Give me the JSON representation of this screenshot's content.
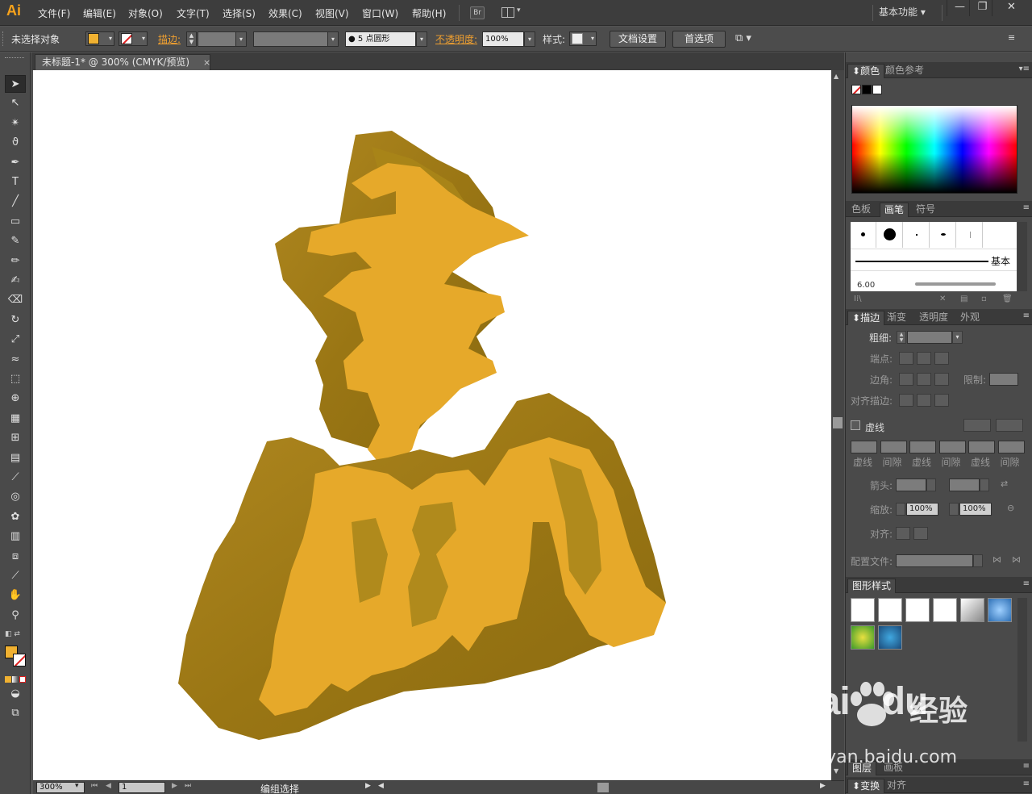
{
  "app": {
    "logo": "Ai"
  },
  "menu": [
    "文件(F)",
    "编辑(E)",
    "对象(O)",
    "文字(T)",
    "选择(S)",
    "效果(C)",
    "视图(V)",
    "窗口(W)",
    "帮助(H)"
  ],
  "bridge_button": "Br",
  "arrange_button": "▾",
  "workspace": "基本功能 ▾",
  "window_buttons": {
    "minimize": "—",
    "restore": "❐",
    "close": "✕"
  },
  "control_bar": {
    "selection_label": "未选择对象",
    "fill_color": "#f0b131",
    "stroke_label": "描边:",
    "brush_label": "●  5  点圆形",
    "opacity_label": "不透明度:",
    "opacity_value": "100%",
    "style_label": "样式:",
    "doc_setup_button": "文档设置",
    "prefs_button": "首选项"
  },
  "document_tab": {
    "title": "未标题-1* @ 300% (CMYK/预览)",
    "close": "×"
  },
  "tools": [
    {
      "name": "selection-tool",
      "glyph": "➤"
    },
    {
      "name": "direct-selection-tool",
      "glyph": "↖"
    },
    {
      "name": "magic-wand-tool",
      "glyph": "✴"
    },
    {
      "name": "lasso-tool",
      "glyph": "ϑ"
    },
    {
      "name": "pen-tool",
      "glyph": "✒"
    },
    {
      "name": "type-tool",
      "glyph": "T"
    },
    {
      "name": "line-tool",
      "glyph": "╱"
    },
    {
      "name": "rectangle-tool",
      "glyph": "▭"
    },
    {
      "name": "paintbrush-tool",
      "glyph": "✎"
    },
    {
      "name": "pencil-tool",
      "glyph": "✏"
    },
    {
      "name": "blob-brush-tool",
      "glyph": "✍"
    },
    {
      "name": "eraser-tool",
      "glyph": "⌫"
    },
    {
      "name": "rotate-tool",
      "glyph": "↻"
    },
    {
      "name": "scale-tool",
      "glyph": "⤢"
    },
    {
      "name": "warp-tool",
      "glyph": "≈"
    },
    {
      "name": "free-transform-tool",
      "glyph": "⬚"
    },
    {
      "name": "shape-builder-tool",
      "glyph": "⊕"
    },
    {
      "name": "perspective-grid-tool",
      "glyph": "▦"
    },
    {
      "name": "mesh-tool",
      "glyph": "⊞"
    },
    {
      "name": "gradient-tool",
      "glyph": "▤"
    },
    {
      "name": "eyedropper-tool",
      "glyph": "⟋"
    },
    {
      "name": "blend-tool",
      "glyph": "◎"
    },
    {
      "name": "symbol-sprayer-tool",
      "glyph": "✿"
    },
    {
      "name": "column-graph-tool",
      "glyph": "▥"
    },
    {
      "name": "artboard-tool",
      "glyph": "⧈"
    },
    {
      "name": "slice-tool",
      "glyph": "⟋"
    },
    {
      "name": "hand-tool",
      "glyph": "✋"
    },
    {
      "name": "zoom-tool",
      "glyph": "⚲"
    }
  ],
  "statusbar": {
    "zoom": "300%",
    "page": "1",
    "status": "编组选择"
  },
  "panels": {
    "color": {
      "tabs": [
        "颜色",
        "颜色参考"
      ]
    },
    "brushes": {
      "tabs": [
        "色板",
        "画笔",
        "符号"
      ],
      "basic_label": "基本",
      "size_label": "6.00"
    },
    "stroke": {
      "tabs": [
        "描边",
        "渐变",
        "透明度",
        "外观"
      ],
      "weight_label": "粗细:",
      "cap_label": "端点:",
      "corner_label": "边角:",
      "limit_label": "限制:",
      "align_label": "对齐描边:",
      "dashed_label": "虚线",
      "dash_cols": [
        "虚线",
        "间隙",
        "虚线",
        "间隙",
        "虚线",
        "间隙"
      ],
      "arrow_label": "箭头:",
      "scale_label": "缩放:",
      "scale_a": "100%",
      "scale_b": "100%",
      "align2_label": "对齐:",
      "profile_label": "配置文件:"
    },
    "graphic_styles": {
      "title": "图形样式"
    },
    "layers": {
      "tabs": [
        "图层",
        "画板"
      ]
    },
    "transform": {
      "tabs": [
        "变换",
        "对齐"
      ]
    }
  },
  "watermark": {
    "logo": "Bai",
    "logo2": "du",
    "cn": "经验",
    "url": "jingyan.baidu.com"
  }
}
